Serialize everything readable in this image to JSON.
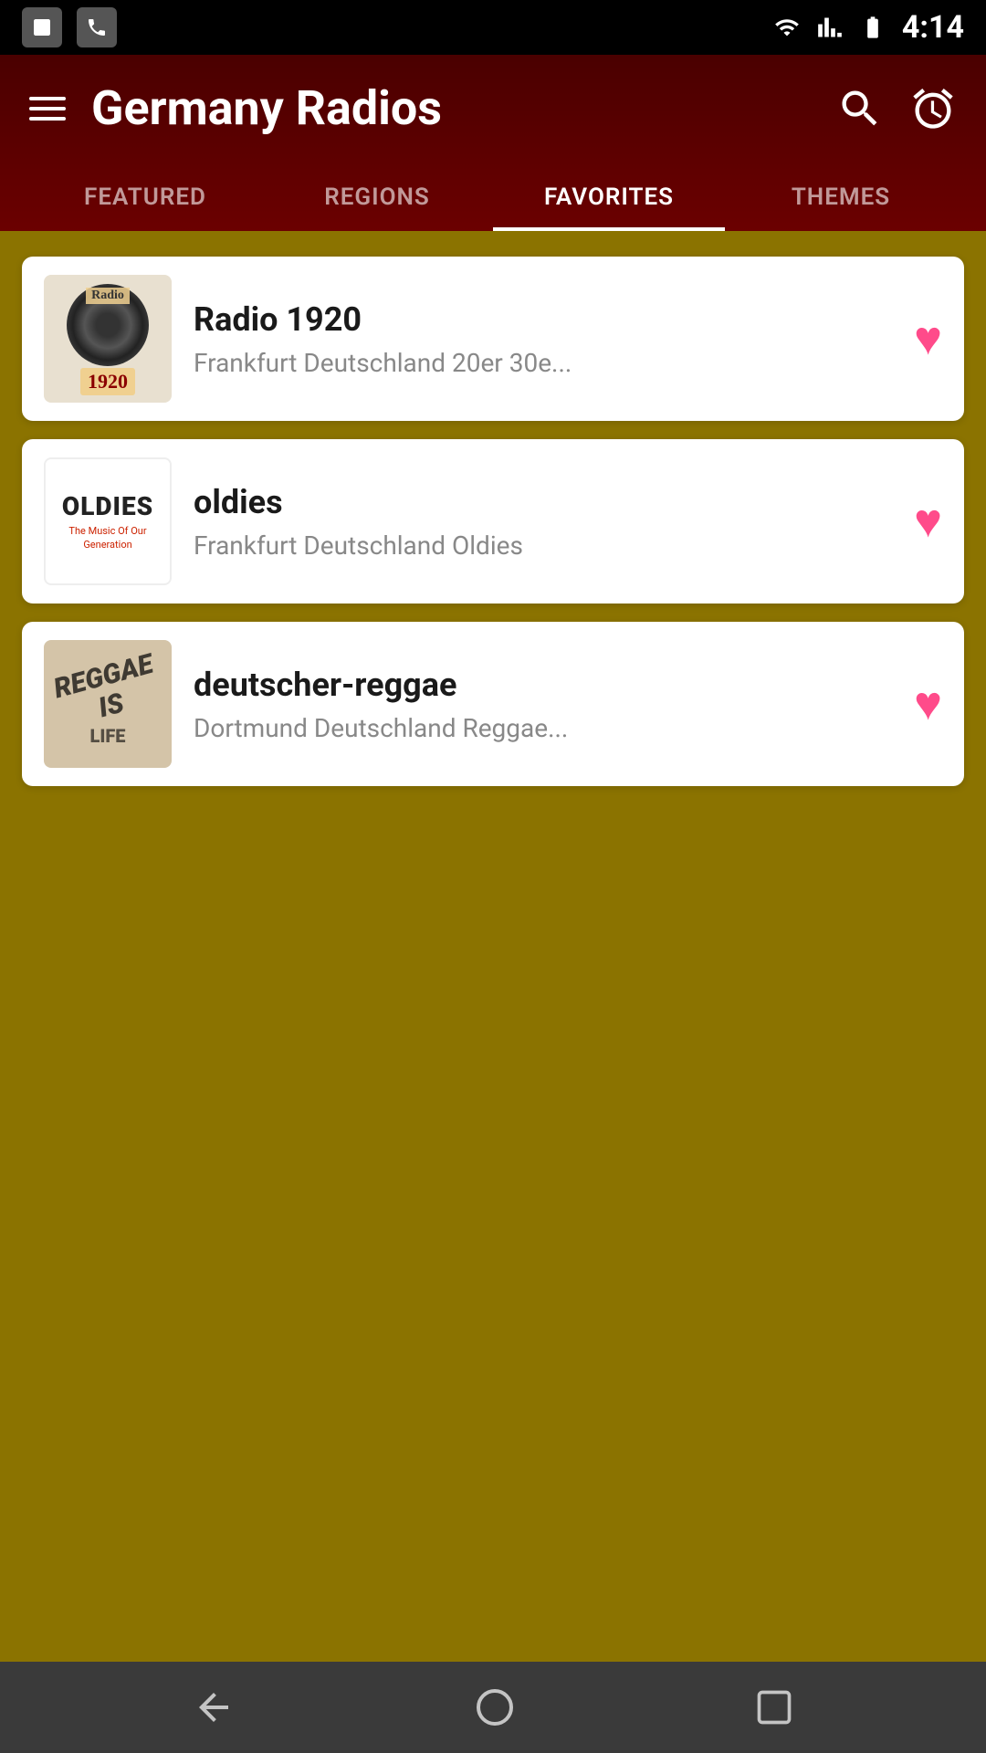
{
  "statusBar": {
    "time": "4:14",
    "icons": [
      "photo",
      "phone",
      "wifi",
      "signal",
      "battery"
    ]
  },
  "header": {
    "title": "Germany Radios",
    "menuLabel": "Menu",
    "searchLabel": "Search",
    "alarmLabel": "Alarm"
  },
  "tabs": [
    {
      "id": "featured",
      "label": "FEATURED",
      "active": false
    },
    {
      "id": "regions",
      "label": "REGIONS",
      "active": false
    },
    {
      "id": "favorites",
      "label": "FAVORITES",
      "active": true
    },
    {
      "id": "themes",
      "label": "THEMES",
      "active": false
    }
  ],
  "radios": [
    {
      "id": "radio1920",
      "name": "Radio 1920",
      "description": "Frankfurt Deutschland 20er 30e...",
      "favorited": true,
      "thumbnailType": "radio1920"
    },
    {
      "id": "oldies",
      "name": "oldies",
      "description": "Frankfurt Deutschland Oldies",
      "favorited": true,
      "thumbnailType": "oldies"
    },
    {
      "id": "deutscher-reggae",
      "name": "deutscher-reggae",
      "description": "Dortmund Deutschland Reggae...",
      "favorited": true,
      "thumbnailType": "reggae"
    }
  ],
  "navBar": {
    "back": "◁",
    "home": "○",
    "recent": "□"
  },
  "colors": {
    "headerBg": "#6b0000",
    "contentBg": "#8B7300",
    "activeTab": "#ffffff",
    "heartColor": "#ff4b8a",
    "cardBg": "#ffffff"
  }
}
